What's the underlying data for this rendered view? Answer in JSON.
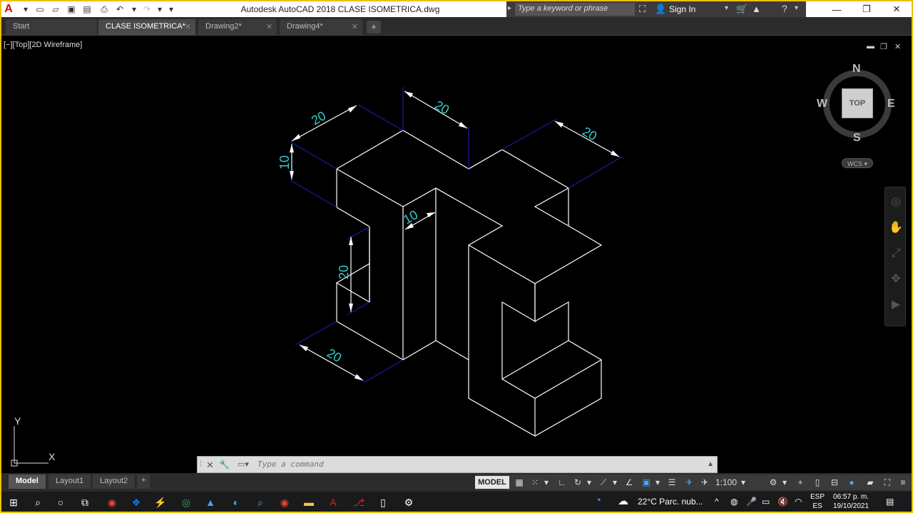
{
  "title_bar": {
    "title": "Autodesk AutoCAD 2018    CLASE ISOMETRICA.dwg",
    "search_placeholder": "Type a keyword or phrase",
    "sign_in": "Sign In"
  },
  "tabs": [
    {
      "label": "Start",
      "active": false
    },
    {
      "label": "CLASE ISOMETRICA*",
      "active": true
    },
    {
      "label": "Drawing2*",
      "active": false
    },
    {
      "label": "Drawing4*",
      "active": false
    }
  ],
  "viewport_label": "[−][Top][2D Wireframe]",
  "viewcube": {
    "top_face": "TOP",
    "n": "N",
    "s": "S",
    "e": "E",
    "w": "W",
    "wcs": "WCS"
  },
  "ucs": {
    "x": "X",
    "y": "Y"
  },
  "dimensions": [
    "20",
    "20",
    "20",
    "10",
    "10",
    "20",
    "20"
  ],
  "command_line": {
    "placeholder": "Type a command"
  },
  "layout_tabs": [
    "Model",
    "Layout1",
    "Layout2"
  ],
  "status_bar": {
    "model": "MODEL",
    "scale": "1:100"
  },
  "taskbar": {
    "weather": "22°C  Parc. nub...",
    "lang_top": "ESP",
    "lang_bottom": "ES",
    "time": "06:57 p. m.",
    "date": "19/10/2021"
  },
  "colors": {
    "model_lines": "#ffffff",
    "dimension_text": "#33cccc",
    "extension_lines": "#1a1aaa",
    "frame_accent": "#f0c000"
  }
}
